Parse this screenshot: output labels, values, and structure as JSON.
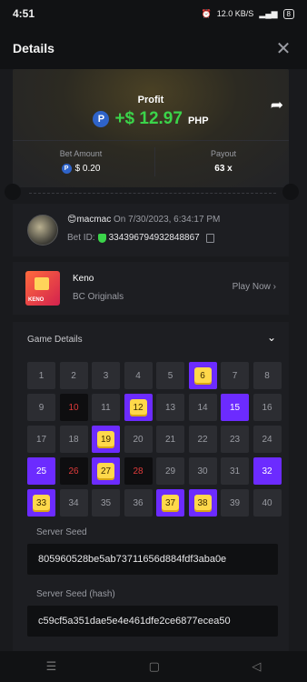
{
  "status_bar": {
    "time": "4:51",
    "net_speed": "12.0 KB/S",
    "battery": "8"
  },
  "header": {
    "title": "Details"
  },
  "profit": {
    "label": "Profit",
    "coin_symbol": "P",
    "amount": "+$ 12.97",
    "currency": "PHP",
    "bet_amount_label": "Bet Amount",
    "bet_amount": "$ 0.20",
    "payout_label": "Payout",
    "payout": "63 x"
  },
  "bet": {
    "user_emoji": "😊",
    "username": "macmac",
    "date_prefix": "On",
    "date": "7/30/2023, 6:34:17 PM",
    "bet_id_label": "Bet ID:",
    "bet_id": "334396794932848867"
  },
  "game": {
    "name": "Keno",
    "provider": "BC Originals",
    "thumb_label": "KENO",
    "play_label": "Play Now"
  },
  "game_details": {
    "title": "Game Details",
    "numbers": [
      {
        "n": "1",
        "s": "n"
      },
      {
        "n": "2",
        "s": "n"
      },
      {
        "n": "3",
        "s": "n"
      },
      {
        "n": "4",
        "s": "n"
      },
      {
        "n": "5",
        "s": "n"
      },
      {
        "n": "6",
        "s": "hit"
      },
      {
        "n": "7",
        "s": "n"
      },
      {
        "n": "8",
        "s": "n"
      },
      {
        "n": "9",
        "s": "n"
      },
      {
        "n": "10",
        "s": "miss"
      },
      {
        "n": "11",
        "s": "n"
      },
      {
        "n": "12",
        "s": "hit"
      },
      {
        "n": "13",
        "s": "n"
      },
      {
        "n": "14",
        "s": "n"
      },
      {
        "n": "15",
        "s": "pick"
      },
      {
        "n": "16",
        "s": "n"
      },
      {
        "n": "17",
        "s": "n"
      },
      {
        "n": "18",
        "s": "n"
      },
      {
        "n": "19",
        "s": "hit"
      },
      {
        "n": "20",
        "s": "n"
      },
      {
        "n": "21",
        "s": "n"
      },
      {
        "n": "22",
        "s": "n"
      },
      {
        "n": "23",
        "s": "n"
      },
      {
        "n": "24",
        "s": "n"
      },
      {
        "n": "25",
        "s": "pick"
      },
      {
        "n": "26",
        "s": "miss"
      },
      {
        "n": "27",
        "s": "hit"
      },
      {
        "n": "28",
        "s": "miss"
      },
      {
        "n": "29",
        "s": "n"
      },
      {
        "n": "30",
        "s": "n"
      },
      {
        "n": "31",
        "s": "n"
      },
      {
        "n": "32",
        "s": "pick"
      },
      {
        "n": "33",
        "s": "hit"
      },
      {
        "n": "34",
        "s": "n"
      },
      {
        "n": "35",
        "s": "n"
      },
      {
        "n": "36",
        "s": "n"
      },
      {
        "n": "37",
        "s": "hit"
      },
      {
        "n": "38",
        "s": "hit"
      },
      {
        "n": "39",
        "s": "n"
      },
      {
        "n": "40",
        "s": "n"
      }
    ],
    "server_seed_label": "Server Seed",
    "server_seed": "805960528be5ab73711656d884fdf3aba0e",
    "server_seed_hash_label": "Server Seed (hash)",
    "server_seed_hash": "c59cf5a351dae5e4e461dfe2ce6877ecea50"
  },
  "colors": {
    "profit_green": "#3bd44a",
    "pick_purple": "#6c2bff",
    "hit_yellow": "#ffd84a",
    "miss_red": "#e03b3b"
  }
}
